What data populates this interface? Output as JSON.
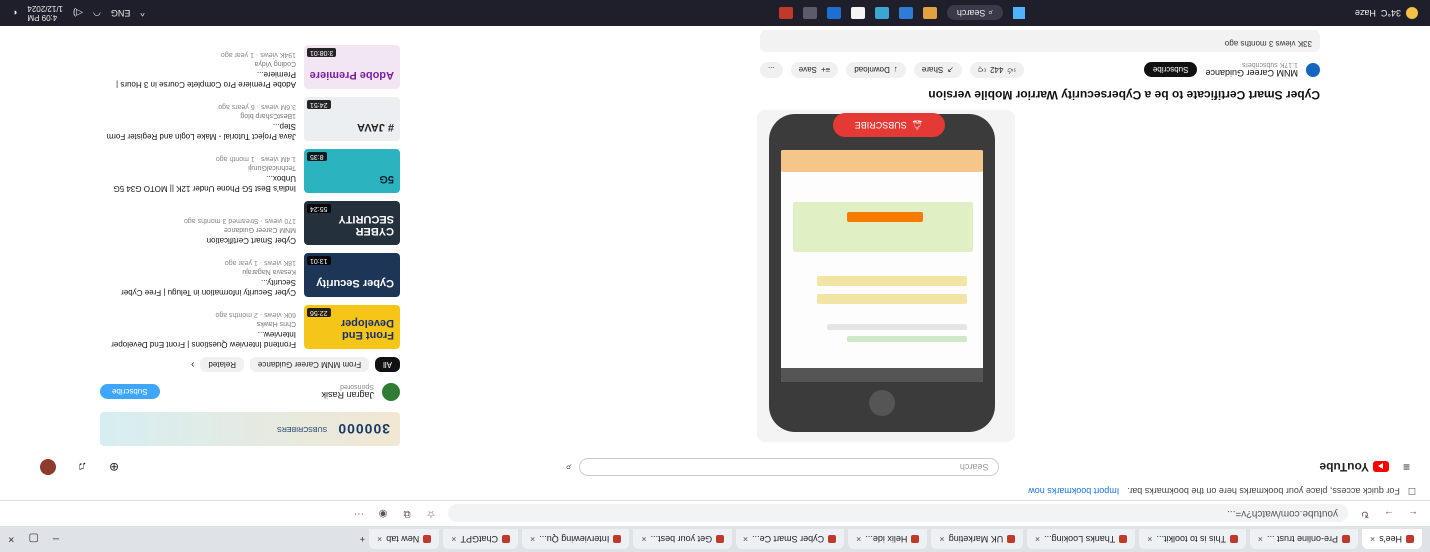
{
  "browser": {
    "tabs": [
      {
        "label": "Hee's"
      },
      {
        "label": "Pre-online trust ..."
      },
      {
        "label": "This is to toolkit..."
      },
      {
        "label": "Thanks Looking..."
      },
      {
        "label": "UK Marketing"
      },
      {
        "label": "Helix ide..."
      },
      {
        "label": "Cyber Smart Ce..."
      },
      {
        "label": "Get your best..."
      },
      {
        "label": "Interviewing Qu..."
      },
      {
        "label": "ChatGPT"
      },
      {
        "label": "New tab"
      }
    ],
    "new_tab_symbol": "+",
    "window_controls": [
      "–",
      "▢",
      "×"
    ],
    "address": "youtube.com/watch?v=...",
    "bookmarks_notice": "For quick access, place your bookmarks here on the bookmarks bar.",
    "bookmarks_link": "Import bookmarks now"
  },
  "youtube": {
    "logo_text": "YouTube",
    "search_placeholder": "Search"
  },
  "video": {
    "overlay_label": "SUBSCRIBE",
    "title": "Cyber Smart Certificate to be a Cybersecurity Warrior Mobile version",
    "channel_name": "MNM Career Guidance",
    "channel_subs": "1.17K subscribers",
    "subscribe_label": "Subscribe",
    "likes": "442",
    "share_label": "Share",
    "download_label": "Download",
    "save_label": "Save",
    "more_label": "...",
    "description": "33K views  3 months ago"
  },
  "sidebar": {
    "ad_big_text": "300000",
    "ad_small_text": "SUBSCRIBERS",
    "sponsor_name": "Jagran Rasik",
    "sponsor_sub": "Sponsored",
    "sponsor_button": "Subscribe",
    "chips": [
      "All",
      "From MNM Career Guidance",
      "Related"
    ],
    "recommendations": [
      {
        "thumb_text": "Front End Developer",
        "duration": "22:56",
        "title": "Frontend Interview Questions | Front End Developer Interview...",
        "channel": "Chris Hawks",
        "stats": "60K views · 2 months ago",
        "bg": "#f5c518",
        "fg": "#1a2f6b"
      },
      {
        "thumb_text": "Cyber Security",
        "duration": "13:01",
        "title": "Cyber Security information in Telugu | Free Cyber Security...",
        "channel": "Kesava Nagaraju",
        "stats": "18K views · 1 year ago",
        "bg": "#1d3557",
        "fg": "#ffffff"
      },
      {
        "thumb_text": "CYBER SECURITY",
        "duration": "55:24",
        "title": "Cyber Smart Certification",
        "channel": "MNM Career Guidance",
        "stats": "170 views · Streamed 3 months ago",
        "bg": "#24313d",
        "fg": "#ffffff"
      },
      {
        "thumb_text": "5G",
        "duration": "8:35",
        "title": "India's Best 5G Phone Under 12K || MOTO G34 5G Unbox...",
        "channel": "TechnicalGuruji",
        "stats": "1.4M views · 1 month ago",
        "bg": "#2bb3c0",
        "fg": "#0b1d2a"
      },
      {
        "thumb_text": "# JAVA",
        "duration": "24:51",
        "title": "Java Project Tutorial - Make Login and Register Form Step...",
        "channel": "1BestCsharp blog",
        "stats": "3.6M views · 6 years ago",
        "bg": "#eceff1",
        "fg": "#222222"
      },
      {
        "thumb_text": "Adobe Premiere",
        "duration": "3:08:01",
        "title": "Adobe Premiere Pro Complete Course in 3 Hours | Premiere...",
        "channel": "Coding Vidya",
        "stats": "194K views · 1 year ago",
        "bg": "#f3e6f3",
        "fg": "#7b1fa2"
      }
    ]
  },
  "taskbar": {
    "weather_temp": "34°C",
    "weather_desc": "Haze",
    "search_label": "Search",
    "language": "ENG",
    "time": "4:09 PM",
    "date": "1/12/2024"
  }
}
